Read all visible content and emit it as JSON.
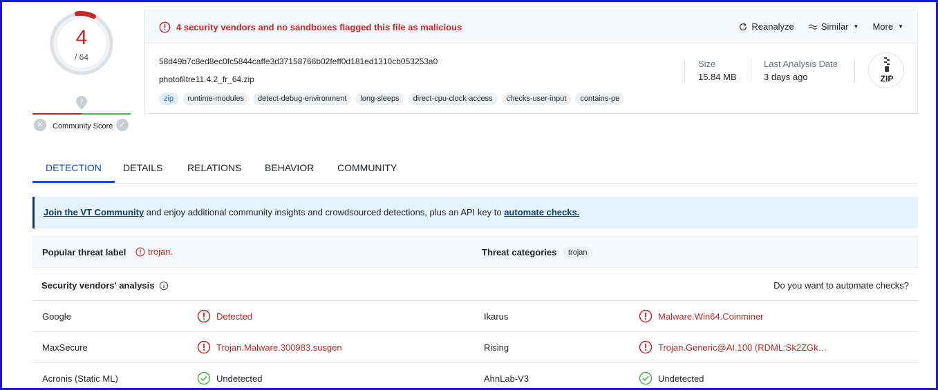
{
  "score": {
    "detections": "4",
    "total": "/ 64",
    "community_label": "Community Score",
    "ring_color": "#c62828"
  },
  "header": {
    "alert_text": "4 security vendors and no sandboxes flagged this file as malicious",
    "actions": {
      "reanalyze": "Reanalyze",
      "similar": "Similar",
      "more": "More"
    },
    "hash": "58d49b7c8ed8ec0fc5844caffe3d37158766b02feff0d181ed1310cb053253a0",
    "filename": "photofiltre11.4.2_fr_64.zip",
    "tags": [
      "zip",
      "runtime-modules",
      "detect-debug-environment",
      "long-sleeps",
      "direct-cpu-clock-access",
      "checks-user-input",
      "contains-pe"
    ],
    "size_label": "Size",
    "size_value": "15.84 MB",
    "date_label": "Last Analysis Date",
    "date_value": "3 days ago",
    "file_type_icon": "ZIP"
  },
  "tabs": [
    "DETECTION",
    "DETAILS",
    "RELATIONS",
    "BEHAVIOR",
    "COMMUNITY"
  ],
  "banner": {
    "link1": "Join the VT Community",
    "text": " and enjoy additional community insights and crowdsourced detections, plus an API key to ",
    "link2": "automate checks."
  },
  "threat": {
    "popular_label": "Popular threat label",
    "popular_value": "trojan.",
    "categories_label": "Threat categories",
    "categories_value": "trojan"
  },
  "vendors": {
    "title": "Security vendors' analysis",
    "automate": "Do you want to automate checks?",
    "rows": [
      [
        {
          "name": "Google",
          "result": "Detected",
          "status": "bad"
        },
        {
          "name": "Ikarus",
          "result": "Malware.Win64.Coinminer",
          "status": "bad"
        }
      ],
      [
        {
          "name": "MaxSecure",
          "result": "Trojan.Malware.300983.susgen",
          "status": "bad"
        },
        {
          "name": "Rising",
          "result": "Trojan.Generic@AI.100 (RDML:Sk2ZGk…",
          "status": "bad"
        }
      ],
      [
        {
          "name": "Acronis (Static ML)",
          "result": "Undetected",
          "status": "ok"
        },
        {
          "name": "AhnLab-V3",
          "result": "Undetected",
          "status": "ok"
        }
      ]
    ]
  },
  "colors": {
    "malicious": "#c62828",
    "clean": "#4caf50",
    "accent": "#0b4dda"
  }
}
